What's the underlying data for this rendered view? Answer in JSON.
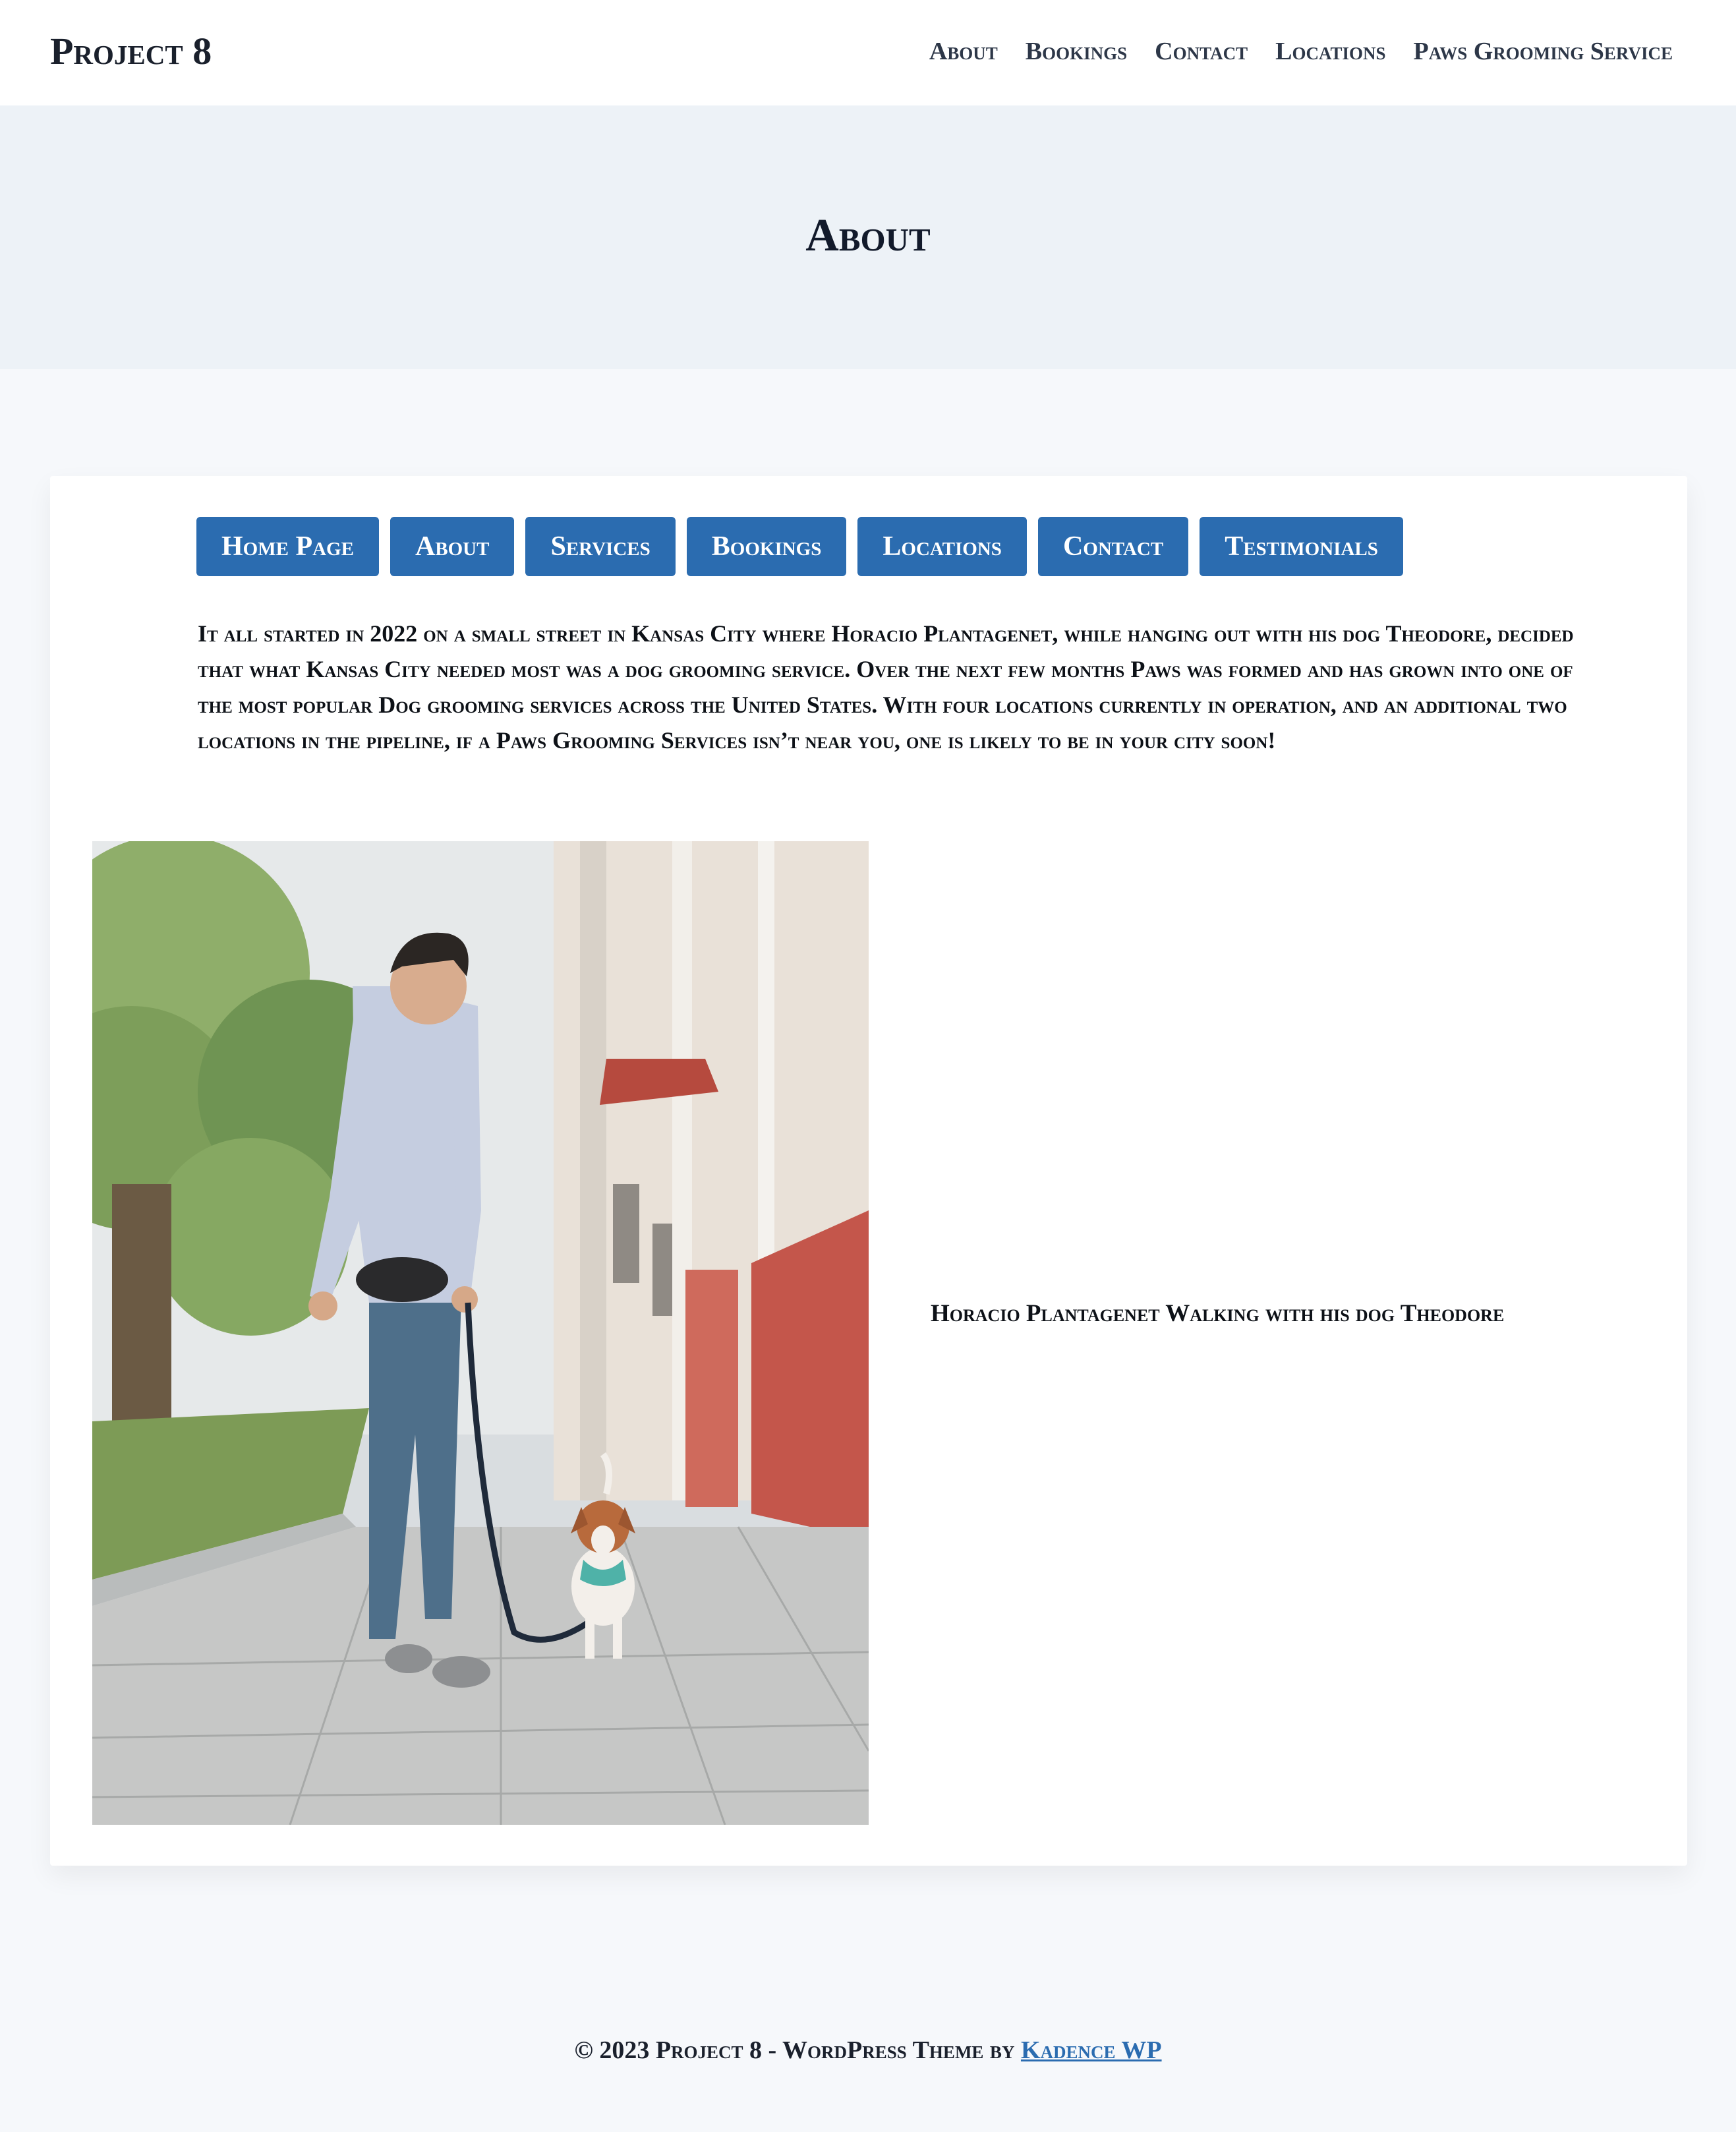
{
  "header": {
    "brand": "Project 8",
    "nav": [
      "About",
      "Bookings",
      "Contact",
      "Locations",
      "Paws Grooming Service"
    ]
  },
  "hero": {
    "title": "About"
  },
  "content": {
    "buttons": [
      "Home Page",
      "About",
      "Services",
      "Bookings",
      "Locations",
      "Contact",
      "Testimonials"
    ],
    "intro": "It all started in 2022 on a small street in Kansas City where Horacio Plantagenet, while hanging out with his dog Theodore, decided that what Kansas City needed most was a dog grooming service. Over the next few months Paws was formed and has grown into one of the most popular Dog grooming services across the United States. With four locations currently in operation, and an additional two locations in the pipeline, if a Paws Grooming Services isn’t near you, one is likely to be in your city soon!",
    "caption": "Horacio Plantagenet Walking with his dog Theodore"
  },
  "footer": {
    "text": "© 2023 Project 8 - WordPress Theme by ",
    "link": "Kadence WP"
  },
  "colors": {
    "accent": "#2b6cb0",
    "header_bg": "#ffffff",
    "band_bg": "#edf2f7",
    "page_bg": "#f6f8fb"
  }
}
